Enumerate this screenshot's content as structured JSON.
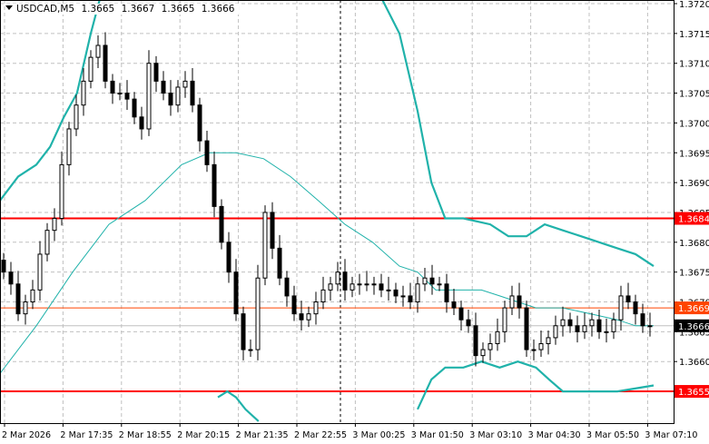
{
  "header": {
    "symbol": "USDCAD,M5",
    "open": "1.3665",
    "high": "1.3667",
    "low": "1.3665",
    "close": "1.3666"
  },
  "colors": {
    "bull_body": "#ffffff",
    "bear_body": "#000000",
    "bands": "#20b2aa",
    "level_red": "#ff0000",
    "level_orange": "#ff4500",
    "bid_line": "#c0c0c0"
  },
  "chart_data": {
    "type": "candlestick",
    "symbol": "USDCAD",
    "timeframe": "M5",
    "ylim": [
      1.365,
      1.3722
    ],
    "price_ticks": [
      "1.3720",
      "1.3715",
      "1.3710",
      "1.3705",
      "1.3700",
      "1.3695",
      "1.3690",
      "1.3685",
      "1.3680",
      "1.3675",
      "1.3670",
      "1.3665",
      "1.3660"
    ],
    "time_ticks": [
      "2 Mar 2026",
      "2 Mar 17:35",
      "2 Mar 18:55",
      "2 Mar 20:15",
      "2 Mar 21:35",
      "2 Mar 22:55",
      "3 Mar 00:25",
      "3 Mar 01:50",
      "3 Mar 03:10",
      "3 Mar 04:30",
      "3 Mar 05:50",
      "3 Mar 07:10"
    ],
    "grid": true,
    "closes": [
      1.3675,
      1.3673,
      1.3668,
      1.367,
      1.3672,
      1.3678,
      1.3682,
      1.3684,
      1.3693,
      1.3699,
      1.3703,
      1.3707,
      1.3711,
      1.3713,
      1.3707,
      1.3705,
      1.3705,
      1.3704,
      1.3701,
      1.3699,
      1.371,
      1.3707,
      1.3705,
      1.3703,
      1.3706,
      1.3707,
      1.3703,
      1.3697,
      1.3693,
      1.3686,
      1.368,
      1.3675,
      1.3668,
      1.3662,
      1.3662,
      1.3674,
      1.3685,
      1.3679,
      1.3674,
      1.3671,
      1.3668,
      1.3667,
      1.3668,
      1.367,
      1.3672,
      1.3673,
      1.3675,
      1.3672,
      1.3673,
      1.3673,
      1.3673,
      1.3673,
      1.3672,
      1.3672,
      1.3671,
      1.3671,
      1.367,
      1.3673,
      1.3674,
      1.3673,
      1.3673,
      1.367,
      1.3669,
      1.3667,
      1.3666,
      1.3661,
      1.3662,
      1.3663,
      1.3665,
      1.3669,
      1.3671,
      1.3669,
      1.3662,
      1.3662,
      1.3663,
      1.3664,
      1.3666,
      1.3667,
      1.3666,
      1.3665,
      1.3666,
      1.3667,
      1.3665,
      1.3665,
      1.3667,
      1.3671,
      1.367,
      1.3668,
      1.3666,
      1.3666
    ],
    "bands": {
      "upper": [
        [
          [
            -0.5,
            1.3687
          ],
          [
            2,
            1.3691
          ],
          [
            4.5,
            1.3693
          ],
          [
            6.4,
            1.3696
          ],
          [
            8.3,
            1.3701
          ],
          [
            10.1,
            1.3705
          ],
          [
            12,
            1.3715
          ],
          [
            13.3,
            1.3721
          ]
        ],
        [
          [
            52,
            1.3721
          ],
          [
            54.5,
            1.3715
          ],
          [
            57,
            1.3702
          ],
          [
            58.9,
            1.369
          ],
          [
            60.8,
            1.3684
          ],
          [
            63.3,
            1.3684
          ],
          [
            67,
            1.3683
          ],
          [
            69.5,
            1.3681
          ],
          [
            72,
            1.3681
          ],
          [
            74.5,
            1.3683
          ],
          [
            77,
            1.3682
          ],
          [
            79.5,
            1.3681
          ],
          [
            82,
            1.368
          ],
          [
            84.5,
            1.3679
          ],
          [
            87,
            1.3678
          ],
          [
            89.5,
            1.3676
          ]
        ]
      ],
      "middle": [
        [
          [
            -0.5,
            1.3658
          ],
          [
            4.5,
            1.3666
          ],
          [
            9.5,
            1.3675
          ],
          [
            14.5,
            1.3683
          ],
          [
            19.5,
            1.3687
          ],
          [
            24.5,
            1.3693
          ],
          [
            28.3,
            1.3695
          ],
          [
            32,
            1.3695
          ],
          [
            35.8,
            1.3694
          ],
          [
            39.5,
            1.3691
          ],
          [
            43.3,
            1.3687
          ],
          [
            47,
            1.3683
          ],
          [
            50.8,
            1.368
          ],
          [
            54.5,
            1.3676
          ],
          [
            57,
            1.3675
          ],
          [
            59.5,
            1.3672
          ],
          [
            62,
            1.3672
          ],
          [
            65.8,
            1.3672
          ],
          [
            68.3,
            1.3671
          ],
          [
            70.8,
            1.367
          ],
          [
            73.3,
            1.3669
          ],
          [
            77,
            1.3669
          ],
          [
            80.8,
            1.3668
          ],
          [
            84.5,
            1.3667
          ],
          [
            87,
            1.3666
          ],
          [
            89.5,
            1.3666
          ]
        ]
      ],
      "lower": [
        [
          [
            29.5,
            1.3654
          ],
          [
            30.8,
            1.3655
          ],
          [
            32,
            1.3654
          ],
          [
            33.3,
            1.3652
          ],
          [
            35.1,
            1.365
          ]
        ],
        [
          [
            57,
            1.3652
          ],
          [
            58.9,
            1.3657
          ],
          [
            60.8,
            1.3659
          ],
          [
            63.3,
            1.3659
          ],
          [
            65.8,
            1.366
          ],
          [
            68.3,
            1.3659
          ],
          [
            70.8,
            1.366
          ],
          [
            73.3,
            1.3659
          ],
          [
            75.1,
            1.3657
          ],
          [
            77,
            1.3655
          ],
          [
            79.5,
            1.3655
          ],
          [
            84.5,
            1.3655
          ],
          [
            89.5,
            1.3656
          ]
        ]
      ]
    },
    "levels": [
      {
        "price": 1.3684,
        "label": "1.3684",
        "color": "#ff0000",
        "width": 2
      },
      {
        "price": 1.3655,
        "label": "1.3655",
        "color": "#ff0000",
        "width": 2
      },
      {
        "price": 1.3669,
        "label": "1.3669",
        "color": "#ff4500",
        "width": 1
      }
    ],
    "bid": {
      "price": 1.3666,
      "label": "1.3666"
    },
    "period_separator_index": 46
  }
}
